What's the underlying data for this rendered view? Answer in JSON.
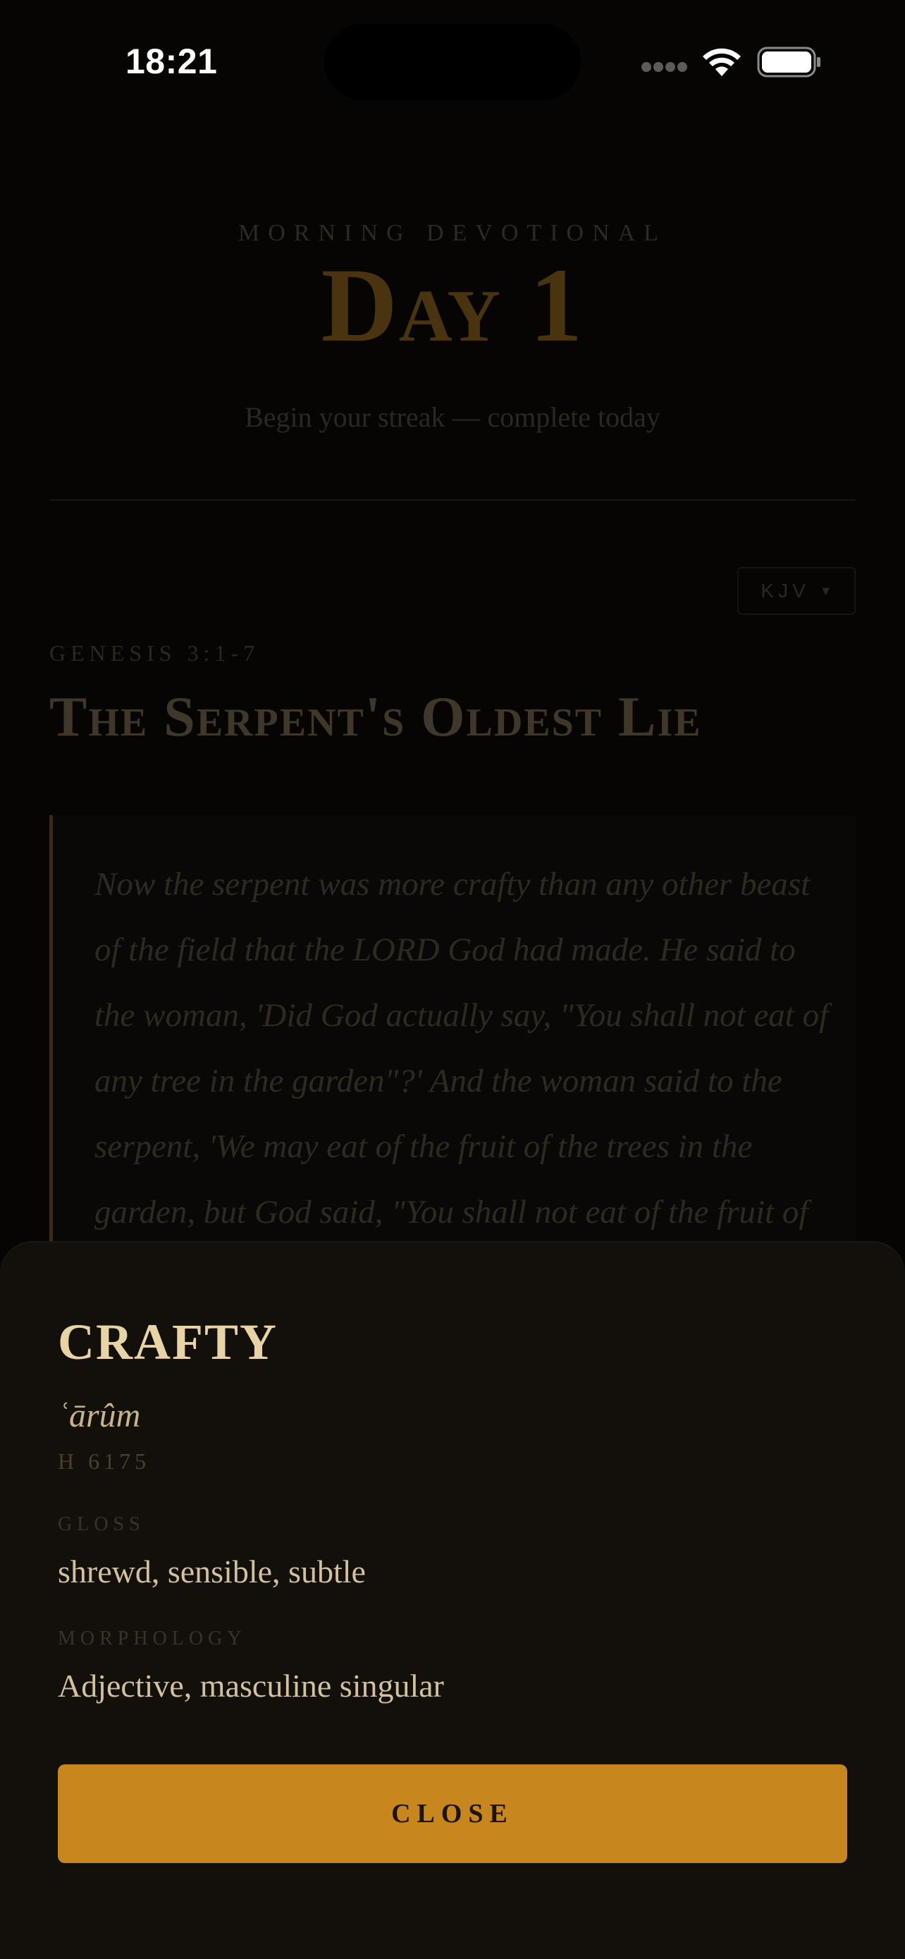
{
  "status_bar": {
    "time": "18:21",
    "icons": [
      "cellular-signal-icon",
      "wifi-icon",
      "battery-icon"
    ]
  },
  "header": {
    "eyebrow": "MORNING DEVOTIONAL",
    "day_title": "Day 1",
    "streak_message": "Begin your streak — complete today"
  },
  "passage": {
    "version": "KJV",
    "version_caret": "▼",
    "reference": "GENESIS 3:1-7",
    "title": "The Serpent's Oldest Lie",
    "text": "Now the serpent was more crafty than any other beast of the field that the LORD God had made. He said to the woman, 'Did God actually say, \"You shall not eat of any tree in the garden\"?' And the woman said to the serpent, 'We may eat of the fruit of the trees in the garden, but God said, \"You shall not eat of the fruit of"
  },
  "word_sheet": {
    "word": "CRAFTY",
    "transliteration": "ʿārûm",
    "strongs": "H 6175",
    "gloss_label": "GLOSS",
    "gloss": "shrewd, sensible, subtle",
    "morphology_label": "MORPHOLOGY",
    "morphology": "Adjective, masculine singular",
    "close_label": "CLOSE"
  },
  "colors": {
    "background": "#060504",
    "sheet": "#13100b",
    "accent": "#c8861e",
    "word": "#e7d3a5"
  }
}
